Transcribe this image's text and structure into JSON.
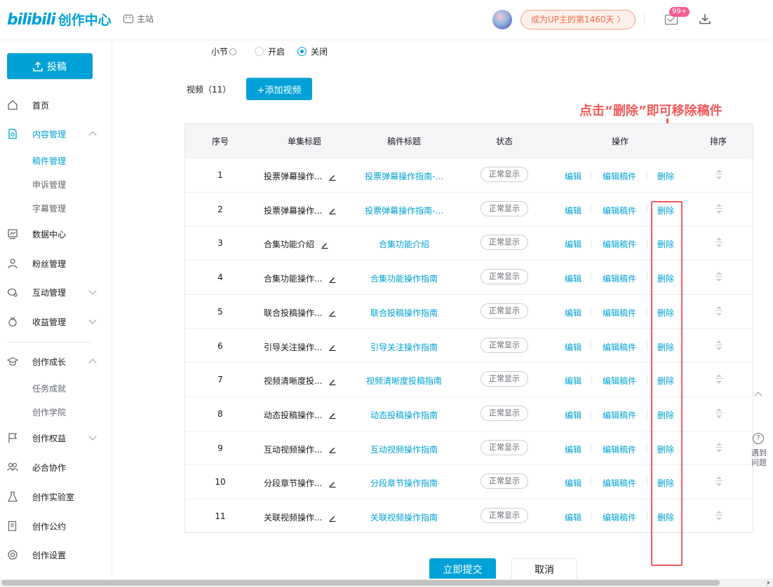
{
  "header": {
    "logo_bili": "bilibili",
    "logo_title": "创作中心",
    "main_site": "主站",
    "up_pill": "成为UP主的第1460天 〉",
    "msg_badge": "99+"
  },
  "sidebar": {
    "upload_label": "投稿",
    "items": [
      {
        "label": "首页"
      },
      {
        "label": "内容管理"
      },
      {
        "label": "数据中心"
      },
      {
        "label": "粉丝管理"
      },
      {
        "label": "互动管理"
      },
      {
        "label": "收益管理"
      },
      {
        "label": "创作成长"
      },
      {
        "label": "创作权益"
      },
      {
        "label": "必合协作"
      },
      {
        "label": "创作实验室"
      },
      {
        "label": "创作公约"
      },
      {
        "label": "创作设置"
      }
    ],
    "content_sub": [
      "稿件管理",
      "申诉管理",
      "字幕管理"
    ],
    "growth_sub": [
      "任务成就",
      "创作学院"
    ]
  },
  "form": {
    "section_label": "小节",
    "radio_on_label": "开启",
    "radio_off_label": "关闭",
    "selected": "关闭",
    "videos_label": "视频（11）",
    "add_video_label": "+添加视频"
  },
  "annotation": "点击“删除”即可移除稿件",
  "table": {
    "headers": [
      "序号",
      "单集标题",
      "稿件标题",
      "状态",
      "操作",
      "排序"
    ],
    "ops": {
      "edit": "编辑",
      "edit_manuscript": "编辑稿件",
      "delete": "删除"
    },
    "rows": [
      {
        "index": "1",
        "episode": "投票弹幕操作...",
        "title": "投票弹幕操作指南-...",
        "status": "正常显示"
      },
      {
        "index": "2",
        "episode": "投票弹幕操作...",
        "title": "投票弹幕操作指南-...",
        "status": "正常显示"
      },
      {
        "index": "3",
        "episode": "合集功能介绍",
        "title": "合集功能介绍",
        "status": "正常显示"
      },
      {
        "index": "4",
        "episode": "合集功能操作...",
        "title": "合集功能操作指南",
        "status": "正常显示"
      },
      {
        "index": "5",
        "episode": "联合投稿操作...",
        "title": "联合投稿操作指南",
        "status": "正常显示"
      },
      {
        "index": "6",
        "episode": "引导关注操作...",
        "title": "引导关注操作指南",
        "status": "正常显示"
      },
      {
        "index": "7",
        "episode": "视频清晰度投...",
        "title": "视频清晰度投稿指南",
        "status": "正常显示"
      },
      {
        "index": "8",
        "episode": "动态投稿操作...",
        "title": "动态投稿操作指南",
        "status": "正常显示"
      },
      {
        "index": "9",
        "episode": "互动视频操作...",
        "title": "互动视频操作指南",
        "status": "正常显示"
      },
      {
        "index": "10",
        "episode": "分段章节操作...",
        "title": "分段章节操作指南",
        "status": "正常显示"
      },
      {
        "index": "11",
        "episode": "关联视频操作...",
        "title": "关联视频操作指南",
        "status": "正常显示"
      }
    ]
  },
  "actions": {
    "submit": "立即提交",
    "cancel": "取消"
  },
  "float": {
    "help_text": "遇到问题",
    "help_glyph": "?"
  },
  "colors": {
    "accent": "#00a1d6",
    "annotation": "#f45a5a",
    "badge": "#f25d8e"
  }
}
